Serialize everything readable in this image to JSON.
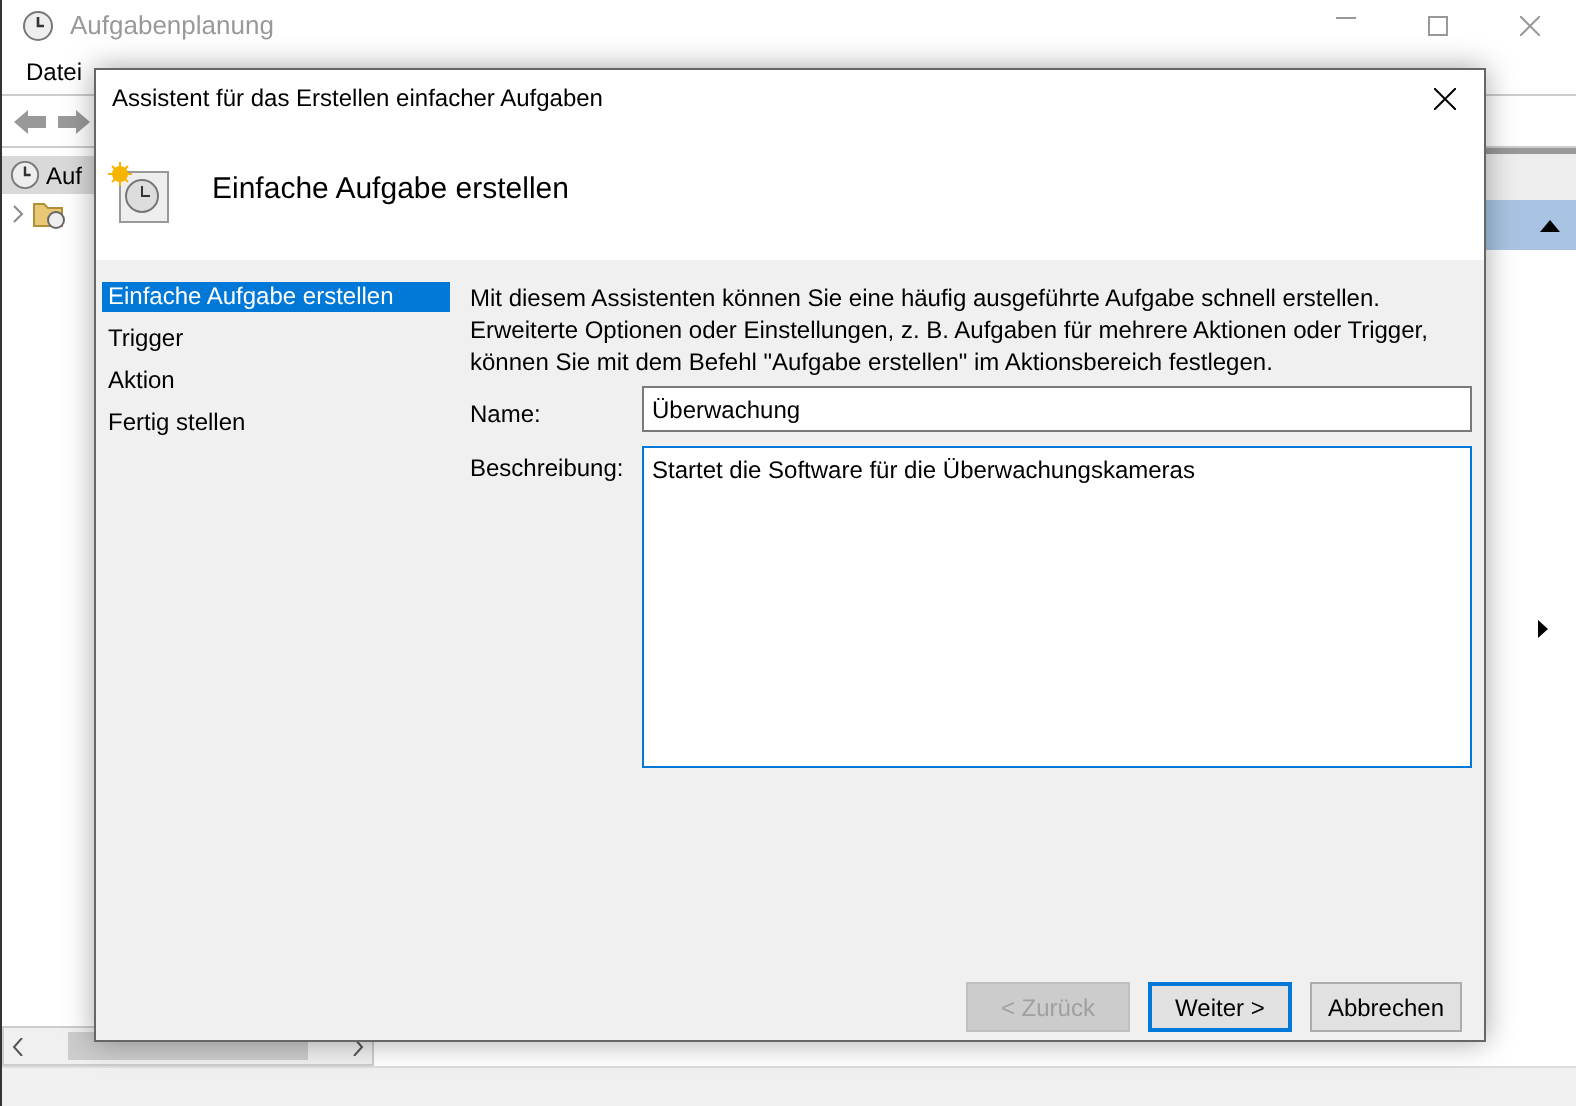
{
  "app_window": {
    "title": "Aufgabenplanung",
    "menu": [
      "Datei"
    ],
    "tree": [
      {
        "label": "Auf",
        "selected": true
      },
      {
        "selected": false,
        "expanded": false
      }
    ]
  },
  "dialog": {
    "title": "Assistent für das Erstellen einfacher Aufgaben",
    "heading": "Einfache Aufgabe erstellen",
    "steps": [
      {
        "label": "Einfache Aufgabe erstellen",
        "selected": true
      },
      {
        "label": "Trigger",
        "selected": false
      },
      {
        "label": "Aktion",
        "selected": false
      },
      {
        "label": "Fertig stellen",
        "selected": false
      }
    ],
    "intro": "Mit diesem Assistenten können Sie eine häufig ausgeführte Aufgabe schnell erstellen. Erweiterte Optionen oder Einstellungen, z. B. Aufgaben für mehrere Aktionen oder Trigger, können Sie mit dem Befehl \"Aufgabe erstellen\" im Aktionsbereich festlegen.",
    "fields": [
      {
        "kind": "input",
        "label": "Name:",
        "value": "Überwachung",
        "focused": false
      },
      {
        "kind": "textarea",
        "label": "Beschreibung:",
        "value": "Startet die Software für die Überwachungskameras",
        "focused": true
      }
    ],
    "buttons": [
      {
        "label": "< Zurück",
        "disabled": true,
        "default": false
      },
      {
        "label": "Weiter >",
        "disabled": false,
        "default": true
      },
      {
        "label": "Abbrechen",
        "disabled": false,
        "default": false
      }
    ]
  }
}
